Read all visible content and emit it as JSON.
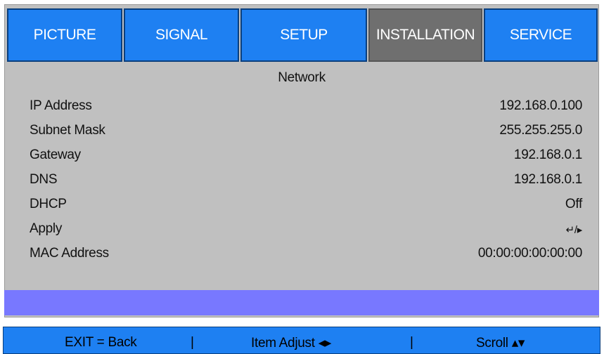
{
  "tabs": [
    {
      "label": "PICTURE",
      "active": false
    },
    {
      "label": "SIGNAL",
      "active": false
    },
    {
      "label": "SETUP",
      "active": false
    },
    {
      "label": "INSTALLATION",
      "active": true
    },
    {
      "label": "SERVICE",
      "active": false
    }
  ],
  "section_title": "Network",
  "rows": [
    {
      "label": "IP Address",
      "value": "192.168.0.100"
    },
    {
      "label": "Subnet Mask",
      "value": "255.255.255.0"
    },
    {
      "label": "Gateway",
      "value": "192.168.0.1"
    },
    {
      "label": "DNS",
      "value": "192.168.0.1"
    },
    {
      "label": "DHCP",
      "value": "Off"
    },
    {
      "label": "Apply",
      "value": "↵/▸"
    },
    {
      "label": "MAC Address",
      "value": "00:00:00:00:00:00"
    }
  ],
  "footer": {
    "exit": "EXIT = Back",
    "sep1": "|",
    "item_adjust": "Item Adjust ◂▸",
    "sep2": "|",
    "scroll": "Scroll ▴▾"
  },
  "colors": {
    "tab_bg": "#1e80f2",
    "tab_active_bg": "#6f6f6f",
    "panel_bg": "#c0c0c0",
    "highlight_bar": "#7878ff",
    "footer_bg": "#1e80f2"
  }
}
